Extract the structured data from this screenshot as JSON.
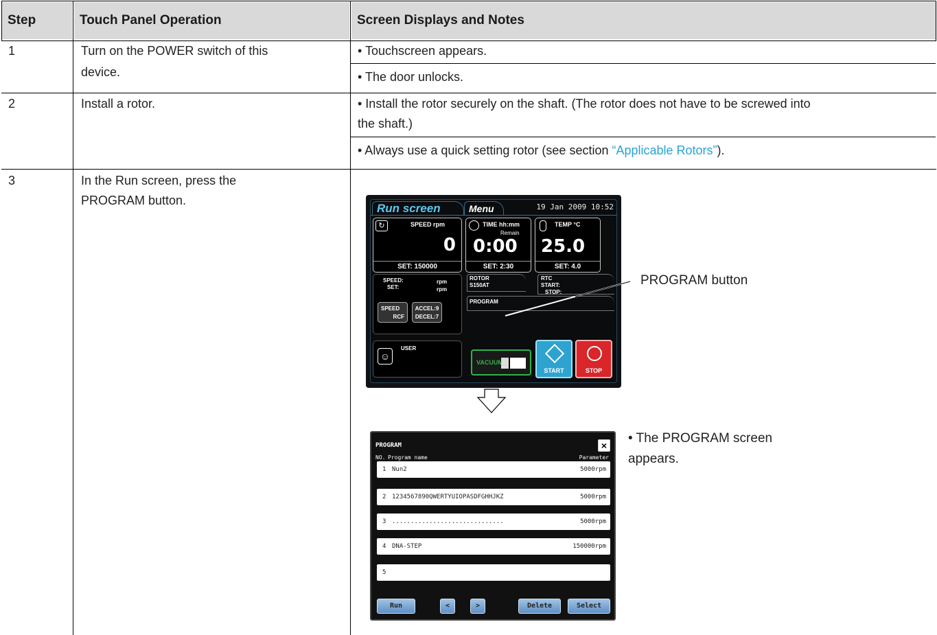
{
  "headers": {
    "step": "Step",
    "operation": "Touch Panel Operation",
    "notes": "Screen Displays and Notes"
  },
  "rows": [
    {
      "step": "1",
      "op1": "Turn on the POWER switch of this",
      "op2": "device.",
      "n1": "• Touchscreen appears.",
      "n2": "• The door unlocks."
    },
    {
      "step": "2",
      "op1": "Install a rotor.",
      "n1": "• Install the rotor securely on the shaft. (The rotor does not have to be screwed into",
      "n1b": "the shaft.)",
      "n2a": "• Always use a quick setting rotor (see section ",
      "n2link": "“Applicable Rotors”",
      "n2b": ")."
    },
    {
      "step": "3",
      "op1": "In the Run screen, press the",
      "op2": "PROGRAM button.",
      "callout": "PROGRAM button",
      "note_a": "• The PROGRAM screen",
      "note_b": "appears."
    }
  ],
  "run_screen": {
    "tab_run": "Run screen",
    "tab_menu": "Menu",
    "datetime": "19  Jan  2009  10:52",
    "speed_label": "SPEED   rpm",
    "speed_value": "0",
    "speed_set": "SET:  150000",
    "time_label": "TIME   hh:mm",
    "time_sub": "Remain",
    "time_value": "0:00",
    "time_set": "SET:  2:30",
    "temp_label": "TEMP    °C",
    "temp_value": "25.0",
    "temp_set": "SET:  4.0",
    "speed_line1": "SPEED:",
    "speed_unit1": "rpm",
    "speed_line2": "SET:",
    "speed_unit2": "rpm",
    "rotor_label": "ROTOR",
    "rotor_value": "S150AT",
    "rtc_label": "RTC",
    "rtc_start": "START:",
    "rtc_stop": "STOP:",
    "program_label": "PROGRAM",
    "speed_rcf_top": "SPEED",
    "speed_rcf_bottom": "RCF",
    "accel": "ACCEL:9",
    "decel": "DECEL:7",
    "user": "USER",
    "vacuum": "VACUUM",
    "start": "START",
    "stop": "STOP",
    "colors": {
      "start": "#2fa3d0",
      "stop": "#d8262b",
      "vacuum": "#2fb54a"
    }
  },
  "program_screen": {
    "title": "PROGRAM",
    "col_no": "NO.",
    "col_name": "Program name",
    "col_param": "Parameter",
    "items": [
      {
        "no": "1",
        "name": "Nun2",
        "param": "5000rpm"
      },
      {
        "no": "2",
        "name": "1234567890QWERTYUIOPASDFGHHJKZ",
        "param": "5000rpm"
      },
      {
        "no": "3",
        "name": "..............................",
        "param": "5000rpm"
      },
      {
        "no": "4",
        "name": "DNA-STEP",
        "param": "150000rpm"
      },
      {
        "no": "5",
        "name": "",
        "param": ""
      }
    ],
    "btn_run": "Run",
    "btn_prev": "<",
    "btn_next": ">",
    "btn_delete": "Delete",
    "btn_select": "Select",
    "close": "×"
  }
}
